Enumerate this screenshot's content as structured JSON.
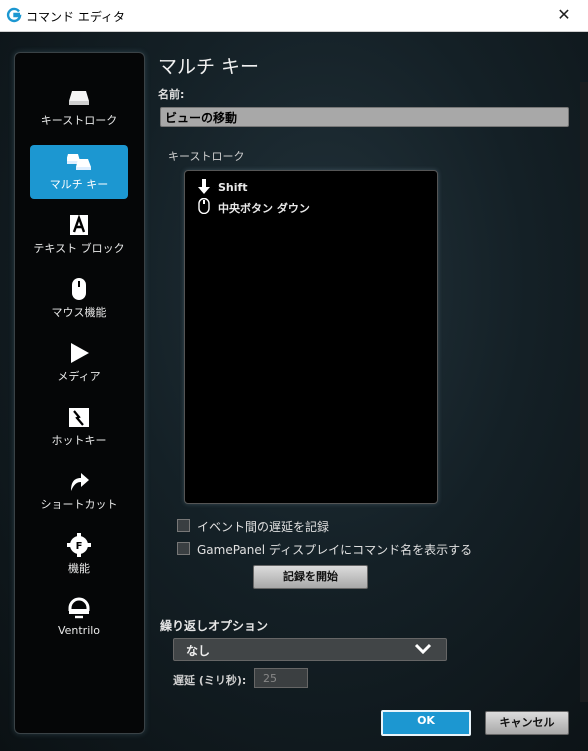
{
  "window": {
    "title": "コマンド エディタ",
    "close_glyph": "✕"
  },
  "sidebar": {
    "items": [
      {
        "label": "キーストローク",
        "icon": "keystroke-icon",
        "active": false
      },
      {
        "label": "マルチ キー",
        "icon": "multikey-icon",
        "active": true
      },
      {
        "label": "テキスト ブロック",
        "icon": "text-block-icon",
        "active": false
      },
      {
        "label": "マウス機能",
        "icon": "mouse-icon",
        "active": false
      },
      {
        "label": "メディア",
        "icon": "play-icon",
        "active": false
      },
      {
        "label": "ホットキー",
        "icon": "hotkey-icon",
        "active": false
      },
      {
        "label": "ショートカット",
        "icon": "shortcut-arrow-icon",
        "active": false
      },
      {
        "label": "機能",
        "icon": "gear-f-icon",
        "active": false
      },
      {
        "label": "Ventrilo",
        "icon": "headset-icon",
        "active": false
      }
    ]
  },
  "main": {
    "title": "マルチ キー",
    "name_label": "名前:",
    "name_value": "ビューの移動",
    "keystroke_label": "キーストローク",
    "keystrokes": [
      {
        "icon": "key-down-arrow-icon",
        "text": "Shift"
      },
      {
        "icon": "mouse-button-icon",
        "text": "中央ボタン ダウン"
      }
    ],
    "checkbox_record_delay": {
      "label": "イベント間の遅延を記録",
      "checked": false
    },
    "checkbox_gamepanel": {
      "label": "GamePanel ディスプレイにコマンド名を表示する",
      "checked": false
    },
    "record_button": "記録を開始",
    "repeat_label": "繰り返しオプション",
    "repeat_value": "なし",
    "delay_label": "遅延 (ミリ秒):",
    "delay_value": "25",
    "ok_button": "OK",
    "cancel_button": "キャンセル"
  },
  "colors": {
    "accent": "#1c97d1",
    "sidebar_bg": "#050607"
  }
}
